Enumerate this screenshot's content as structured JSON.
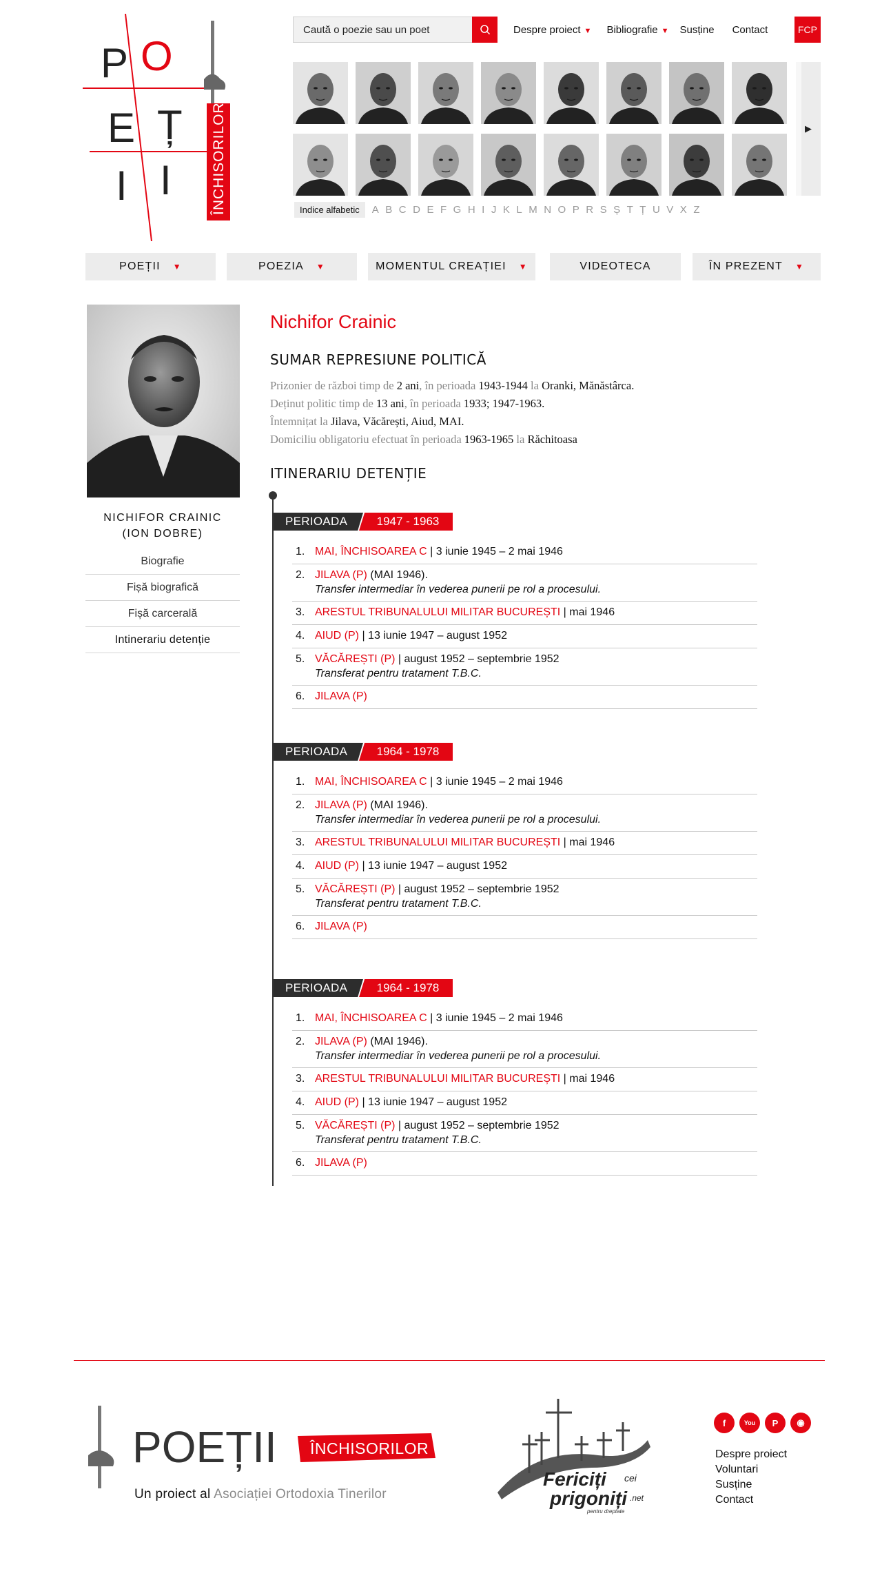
{
  "brand": {
    "logo_letters": [
      "P",
      "O",
      "E",
      "Ț",
      "I",
      "I"
    ],
    "logo_tag": "ÎNCHISORILOR",
    "accent": "#e30613",
    "dark": "#2d2d2d"
  },
  "search": {
    "placeholder": "Caută o poezie sau un poet",
    "icon": "search-icon"
  },
  "topnav": {
    "items": [
      {
        "label": "Despre proiect",
        "has_caret": true
      },
      {
        "label": "Bibliografie",
        "has_caret": true
      },
      {
        "label": "Susține",
        "has_caret": false
      },
      {
        "label": "Contact",
        "has_caret": false
      }
    ],
    "fcp": "FCP"
  },
  "portraits": {
    "count": 16,
    "next_icon": "▶"
  },
  "alphabet": {
    "index_label": "Indice alfabetic",
    "letters": [
      "A",
      "B",
      "C",
      "D",
      "E",
      "F",
      "G",
      "H",
      "I",
      "J",
      "K",
      "L",
      "M",
      "N",
      "O",
      "P",
      "R",
      "S",
      "Ș",
      "T",
      "Ț",
      "U",
      "V",
      "X",
      "Z"
    ]
  },
  "mainnav": [
    {
      "label": "POEȚII",
      "has_caret": true
    },
    {
      "label": "POEZIA",
      "has_caret": true
    },
    {
      "label": "MOMENTUL CREAȚIEI",
      "has_caret": true
    },
    {
      "label": "VIDEOTECA",
      "has_caret": false
    },
    {
      "label": "ÎN PREZENT",
      "has_caret": true
    }
  ],
  "sidebar": {
    "name_line1": "NICHIFOR CRAINIC",
    "name_line2": "(ION DOBRE)",
    "menu": [
      "Biografie",
      "Fișă biografică",
      "Fișă carcerală",
      "Intinerariu detenție"
    ],
    "active_index": 3
  },
  "content": {
    "title": "Nichifor Crainic",
    "summary_heading": "SUMAR REPRESIUNE POLITICĂ",
    "summary": [
      [
        [
          "Prizonier de război timp de ",
          false
        ],
        [
          "2 ani",
          true
        ],
        [
          ", în perioada ",
          false
        ],
        [
          "1943-1944",
          true
        ],
        [
          " la ",
          false
        ],
        [
          "Oranki, Mănăstârca.",
          true
        ]
      ],
      [
        [
          "Deținut politic timp de ",
          false
        ],
        [
          "13 ani",
          true
        ],
        [
          ", în perioada ",
          false
        ],
        [
          "1933; 1947-1963.",
          true
        ]
      ],
      [
        [
          "Întemnițat la ",
          false
        ],
        [
          "Jilava, Văcărești, Aiud, MAI.",
          true
        ]
      ],
      [
        [
          "Domiciliu obligatoriu efectuat în perioada ",
          false
        ],
        [
          "1963-1965",
          true
        ],
        [
          " la ",
          false
        ],
        [
          "Răchitoasa",
          true
        ]
      ]
    ],
    "itinerary_heading": "ITINERARIU DETENȚIE",
    "period_label": "PERIOADA",
    "periods": [
      {
        "years": "1947 - 1963",
        "items": [
          {
            "place": "MAI, ÎNCHISOAREA C",
            "rest": " | 3 iunie 1945 – 2 mai 1946",
            "note": ""
          },
          {
            "place": "JILAVA (P)",
            "rest": " (MAI 1946).",
            "note": "Transfer intermediar în vederea  punerii pe rol a procesului."
          },
          {
            "place": "ARESTUL TRIBUNALULUI MILITAR BUCUREȘTI",
            "rest": " | mai 1946",
            "note": ""
          },
          {
            "place": "AIUD (P)",
            "rest": " | 13 iunie 1947 – august 1952",
            "note": ""
          },
          {
            "place": "VĂCĂREȘTI (P)",
            "rest": " | august 1952 – septembrie 1952",
            "note": "Transferat pentru tratament T.B.C."
          },
          {
            "place": "JILAVA (P)",
            "rest": "",
            "note": ""
          }
        ]
      },
      {
        "years": "1964 - 1978",
        "items": [
          {
            "place": "MAI, ÎNCHISOAREA C",
            "rest": " | 3 iunie 1945 – 2 mai 1946",
            "note": ""
          },
          {
            "place": "JILAVA (P)",
            "rest": " (MAI 1946).",
            "note": "Transfer intermediar în vederea  punerii pe rol a procesului."
          },
          {
            "place": "ARESTUL TRIBUNALULUI MILITAR BUCUREȘTI",
            "rest": " | mai 1946",
            "note": ""
          },
          {
            "place": "AIUD (P)",
            "rest": " | 13 iunie 1947 – august 1952",
            "note": ""
          },
          {
            "place": "VĂCĂREȘTI (P)",
            "rest": " | august 1952 – septembrie 1952",
            "note": "Transferat pentru tratament T.B.C."
          },
          {
            "place": "JILAVA (P)",
            "rest": "",
            "note": ""
          }
        ]
      },
      {
        "years": "1964 - 1978",
        "items": [
          {
            "place": "MAI, ÎNCHISOAREA C",
            "rest": " | 3 iunie 1945 – 2 mai 1946",
            "note": ""
          },
          {
            "place": "JILAVA (P)",
            "rest": " (MAI 1946).",
            "note": "Transfer intermediar în vederea  punerii pe rol a procesului."
          },
          {
            "place": "ARESTUL TRIBUNALULUI MILITAR BUCUREȘTI",
            "rest": " | mai 1946",
            "note": ""
          },
          {
            "place": "AIUD (P)",
            "rest": " | 13 iunie 1947 – august 1952",
            "note": ""
          },
          {
            "place": "VĂCĂREȘTI (P)",
            "rest": " | august 1952 – septembrie 1952",
            "note": "Transferat pentru tratament T.B.C."
          },
          {
            "place": "JILAVA (P)",
            "rest": "",
            "note": ""
          }
        ]
      }
    ]
  },
  "footer": {
    "logo_word": "POEȚII",
    "logo_tag": "ÎNCHISORILOR",
    "subtitle_prefix": "Un proiect al ",
    "subtitle_org": "Asociației Ortodoxia Tinerilor",
    "fericiti_line1": "Fericiți",
    "fericiti_cei": "cei",
    "fericiti_line2": "prigoniți",
    "fericiti_net": ".net",
    "fericiti_tag": "pentru dreptate",
    "social": [
      {
        "name": "facebook-icon",
        "glyph": "f"
      },
      {
        "name": "youtube-icon",
        "glyph": "You"
      },
      {
        "name": "paypal-icon",
        "glyph": "P"
      },
      {
        "name": "rss-icon",
        "glyph": "◉"
      }
    ],
    "links": [
      "Despre proiect",
      "Voluntari",
      "Susține",
      "Contact"
    ]
  }
}
